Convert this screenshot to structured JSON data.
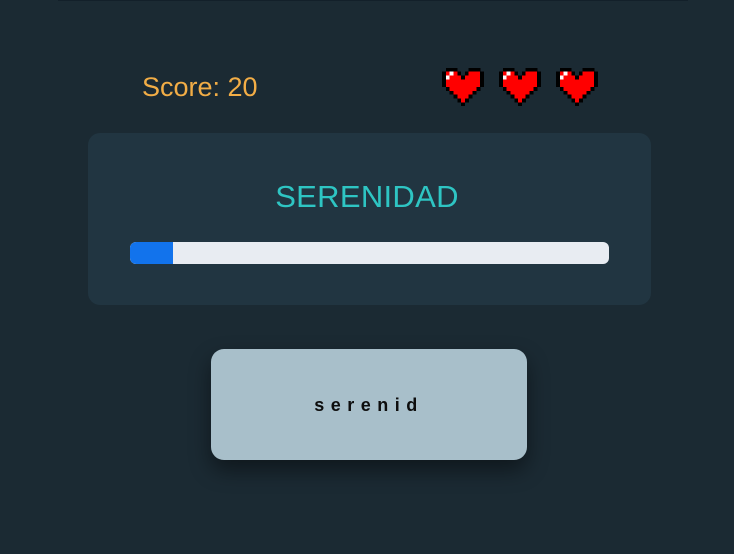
{
  "game": {
    "score_text": "Score: 20",
    "lives": 3,
    "target_word": "SERENIDAD",
    "typed_text": "serenid",
    "progress_fraction": 0.09
  },
  "icons": {
    "life": "heart-icon"
  },
  "colors": {
    "background": "#1b2a33",
    "panel": "#213541",
    "score": "#f2ad46",
    "target_word": "#2ec5c3",
    "progress_fill": "#1273ec",
    "progress_track": "#e8ecf2",
    "typed_box": "#a8bfca",
    "heart": "#ff0000"
  }
}
